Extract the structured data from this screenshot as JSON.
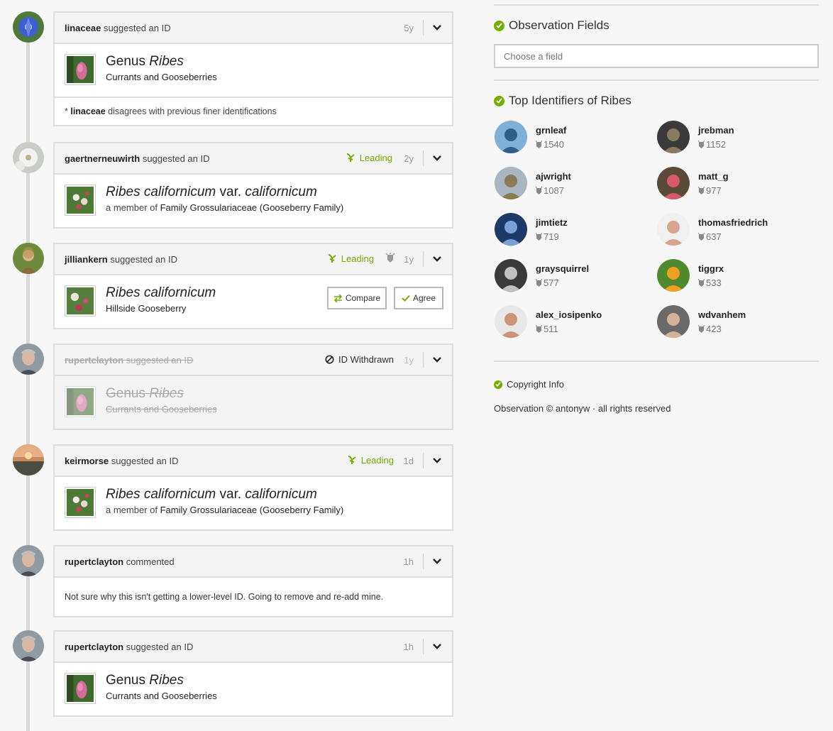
{
  "timeline": [
    {
      "user": "linaceae",
      "action": "suggested an ID",
      "time": "5y",
      "rank": "Genus",
      "taxon": "Ribes",
      "common": "Currants and Gooseberries",
      "note_user": "linaceae",
      "note_text": "disagrees with previous finer identifications"
    },
    {
      "user": "gaertnerneuwirth",
      "action": "suggested an ID",
      "leading": "Leading",
      "time": "2y",
      "taxon": "Ribes californicum",
      "infra": "var.",
      "infra_name": "californicum",
      "member_prefix": "a member of",
      "member": "Family Grossulariaceae (Gooseberry Family)"
    },
    {
      "user": "jilliankern",
      "action": "suggested an ID",
      "leading": "Leading",
      "time": "1y",
      "taxon": "Ribes californicum",
      "common": "Hillside Gooseberry",
      "compare": "Compare",
      "agree": "Agree"
    },
    {
      "user": "rupertclayton",
      "action": "suggested an ID",
      "withdrawn": "ID Withdrawn",
      "time": "1y",
      "rank": "Genus",
      "taxon": "Ribes",
      "common": "Currants and Gooseberries"
    },
    {
      "user": "keirmorse",
      "action": "suggested an ID",
      "leading": "Leading",
      "time": "1d",
      "taxon": "Ribes californicum",
      "infra": "var.",
      "infra_name": "californicum",
      "member_prefix": "a member of",
      "member": "Family Grossulariaceae (Gooseberry Family)"
    },
    {
      "user": "rupertclayton",
      "action": "commented",
      "time": "1h",
      "comment": "Not sure why this isn't getting a lower-level ID. Going to remove and re-add mine."
    },
    {
      "user": "rupertclayton",
      "action": "suggested an ID",
      "time": "1h",
      "rank": "Genus",
      "taxon": "Ribes",
      "common": "Currants and Gooseberries"
    }
  ],
  "sidebar": {
    "obs_fields_title": "Observation Fields",
    "field_placeholder": "Choose a field",
    "top_ids_title": "Top Identifiers of Ribes",
    "identifiers": [
      {
        "name": "grnleaf",
        "count": "1540"
      },
      {
        "name": "jrebman",
        "count": "1152"
      },
      {
        "name": "ajwright",
        "count": "1087"
      },
      {
        "name": "matt_g",
        "count": "977"
      },
      {
        "name": "jimtietz",
        "count": "719"
      },
      {
        "name": "thomasfriedrich",
        "count": "637"
      },
      {
        "name": "graysquirrel",
        "count": "577"
      },
      {
        "name": "tiggrx",
        "count": "533"
      },
      {
        "name": "alex_iosipenko",
        "count": "511"
      },
      {
        "name": "wdvanhem",
        "count": "423"
      }
    ],
    "copyright_title": "Copyright Info",
    "copyright_text": "Observation © antonyw · all rights reserved"
  },
  "colors": {
    "accent": "#74ac00",
    "border": "#dedede",
    "header_bg": "#f4f4f4"
  }
}
